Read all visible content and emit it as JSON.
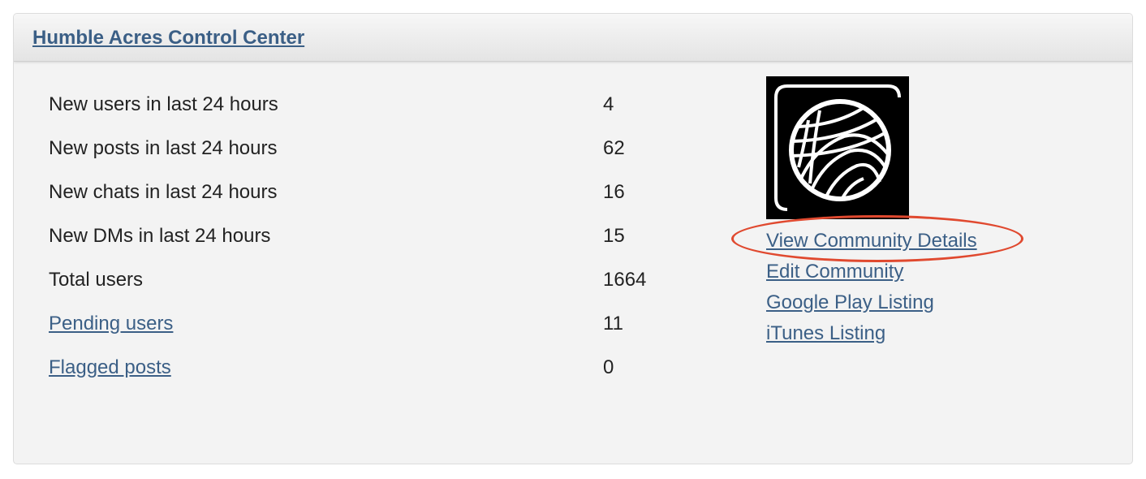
{
  "panel": {
    "title": "Humble Acres Control Center"
  },
  "stats": [
    {
      "label": "New users in last 24 hours",
      "value": "4",
      "is_link": false
    },
    {
      "label": "New posts in last 24 hours",
      "value": "62",
      "is_link": false
    },
    {
      "label": "New chats in last 24 hours",
      "value": "16",
      "is_link": false
    },
    {
      "label": "New DMs in last 24 hours",
      "value": "15",
      "is_link": false
    },
    {
      "label": "Total users",
      "value": "1664",
      "is_link": false
    },
    {
      "label": "Pending users",
      "value": "11",
      "is_link": true
    },
    {
      "label": "Flagged posts",
      "value": "0",
      "is_link": true
    }
  ],
  "community": {
    "logo_icon": "yarn-ball-icon",
    "links": [
      {
        "label": "View Community Details",
        "highlighted": true
      },
      {
        "label": "Edit Community",
        "highlighted": false
      },
      {
        "label": "Google Play Listing",
        "highlighted": false
      },
      {
        "label": "iTunes Listing",
        "highlighted": false
      }
    ]
  },
  "colors": {
    "link": "#3b5f86",
    "highlight": "#e0492f",
    "panel_bg": "#f3f3f3"
  }
}
